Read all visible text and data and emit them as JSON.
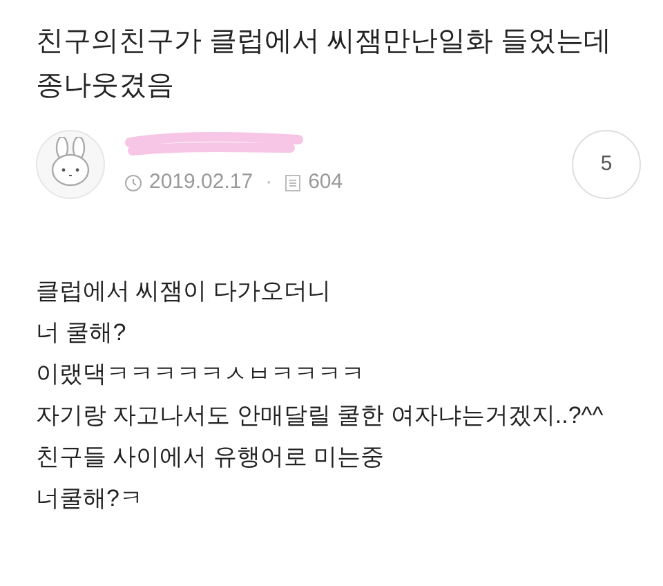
{
  "post": {
    "title": "친구의친구가 클럽에서 씨잼만난일화 들었는데 종나웃겼음",
    "author": {
      "redacted": true
    },
    "date": "2019.02.17",
    "separator": "·",
    "views": "604",
    "comment_count": "5",
    "body_lines": [
      "클럽에서 씨잼이 다가오더니",
      "너 쿨해?",
      "이랬댁ㅋㅋㅋㅋㅋㅅㅂㅋㅋㅋㅋ",
      "자기랑 자고나서도 안매달릴 쿨한 여자냐는거겠지..?^^",
      "친구들 사이에서 유행어로 미는중",
      "너쿨해?ㅋ"
    ]
  }
}
